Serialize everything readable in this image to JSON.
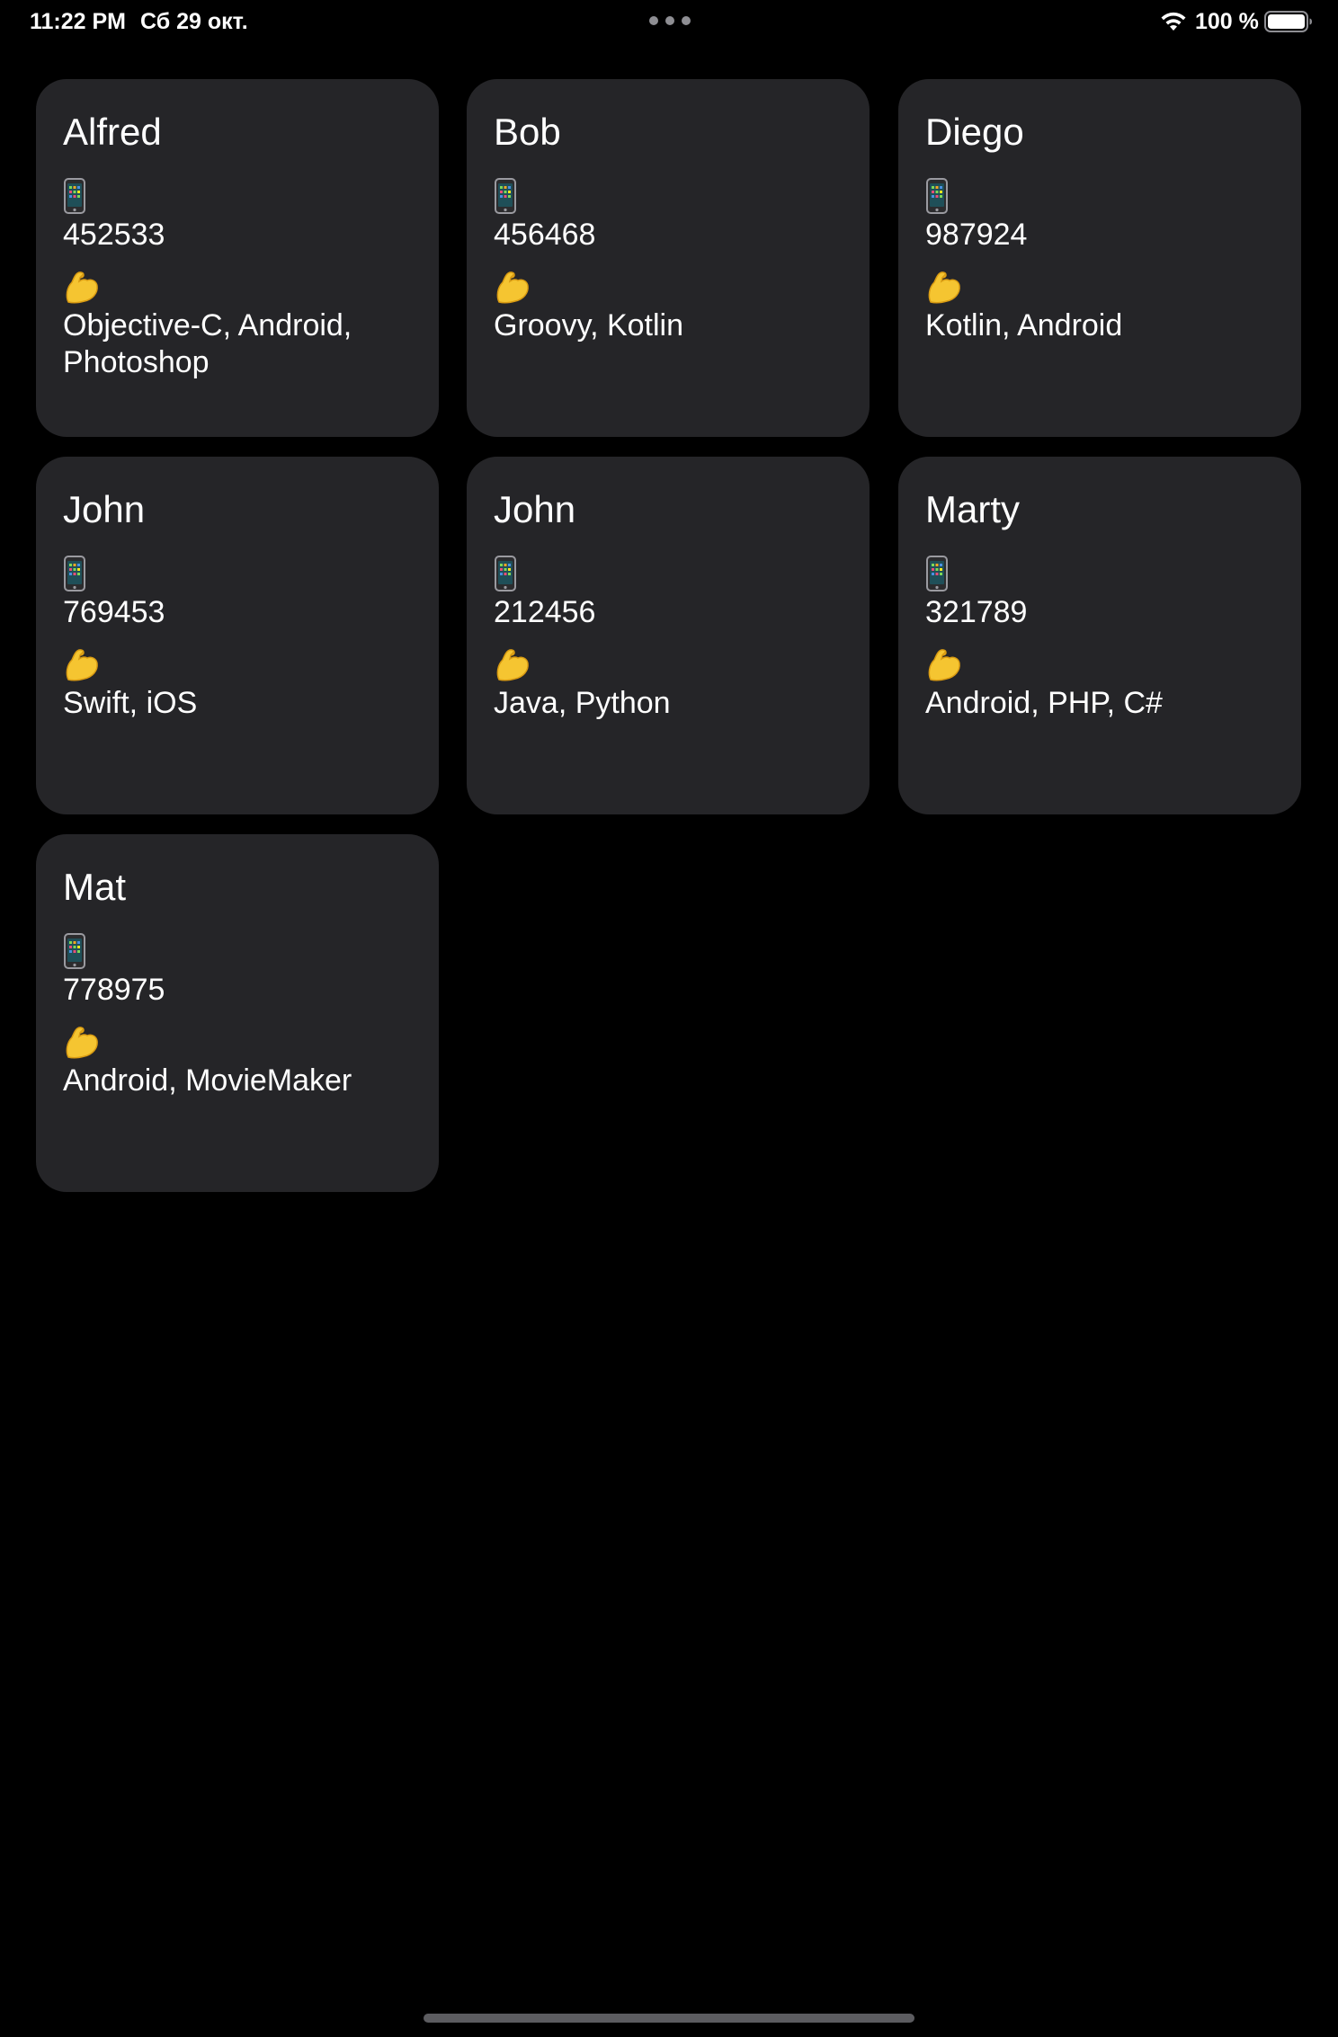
{
  "status_bar": {
    "time": "11:22 PM",
    "date": "Сб 29 окт.",
    "battery_percent": "100 %",
    "battery_level": 1.0,
    "icons": [
      "wifi-icon",
      "battery-icon"
    ]
  },
  "colors": {
    "background": "#000000",
    "card_background": "#252528",
    "text": "#ffffff",
    "phone_icon": "mobile-phone-emoji",
    "skills_icon": "flexed-biceps-emoji"
  },
  "contacts": [
    {
      "name": "Alfred",
      "phone": "452533",
      "skills": "Objective-C, Android, Photoshop"
    },
    {
      "name": "Bob",
      "phone": "456468",
      "skills": "Groovy, Kotlin"
    },
    {
      "name": "Diego",
      "phone": "987924",
      "skills": "Kotlin, Android"
    },
    {
      "name": "John",
      "phone": "769453",
      "skills": "Swift, iOS"
    },
    {
      "name": "John",
      "phone": "212456",
      "skills": "Java, Python"
    },
    {
      "name": "Marty",
      "phone": "321789",
      "skills": "Android, PHP, C#"
    },
    {
      "name": "Mat",
      "phone": "778975",
      "skills": "Android, MovieMaker"
    }
  ]
}
